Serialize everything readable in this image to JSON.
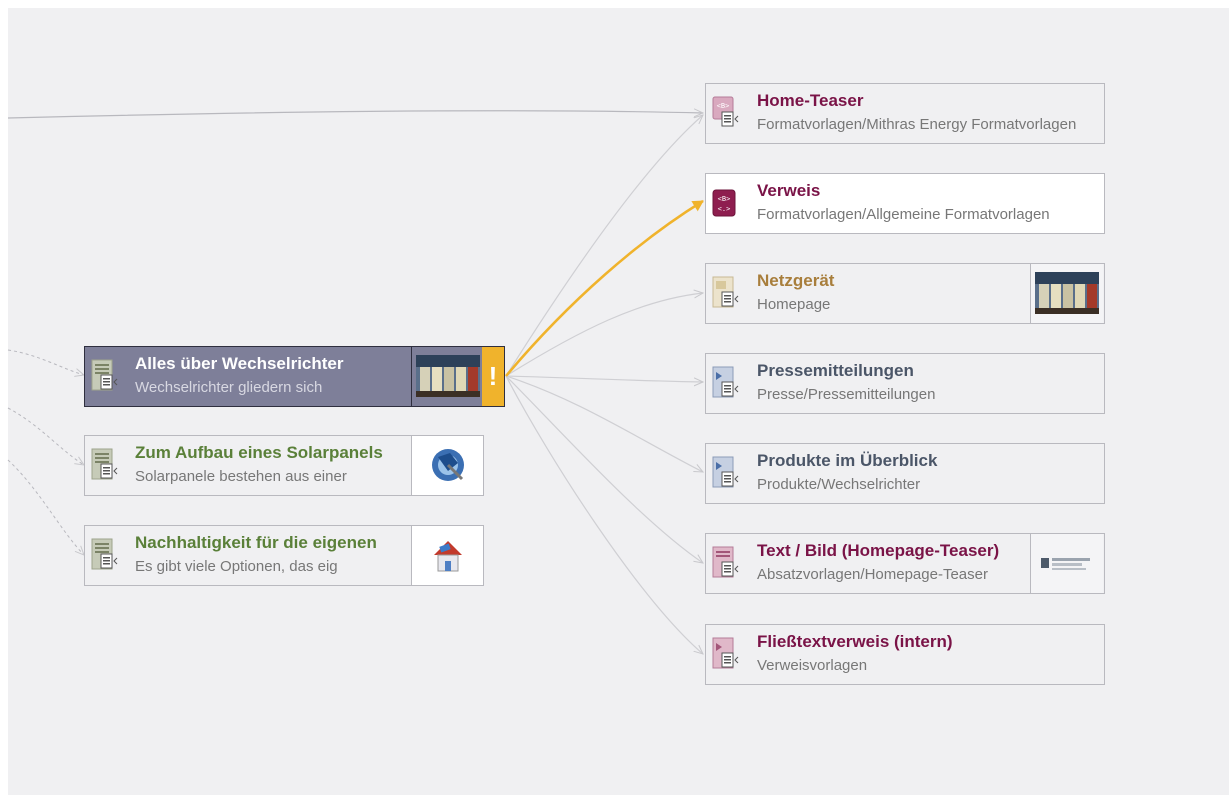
{
  "colors": {
    "canvas": "#f0f0f2",
    "edge": "#c8c8cc",
    "edge_highlight": "#f0b32c",
    "title_purple": "#7a1347",
    "title_slate": "#4b5668",
    "title_gold": "#a87e3c",
    "title_green": "#5a8039",
    "selected_bg": "#7e7f99",
    "warning": "#f0b32c"
  },
  "left_nodes": [
    {
      "title": "Alles über Wechselrichter",
      "subtitle": "Wechselrichter gliedern sich",
      "icon": "page-template-icon",
      "thumb": "product-photo-thumbnail",
      "warning": "!",
      "selected": true
    },
    {
      "title": "Zum Aufbau eines Solarpanels",
      "subtitle": "Solarpanele bestehen aus einer",
      "icon": "page-template-icon",
      "thumb": "solar-globe-thumbnail",
      "selected": false
    },
    {
      "title": "Nachhaltigkeit für die eigenen",
      "subtitle": "Es gibt viele Optionen, das eig",
      "icon": "page-template-icon",
      "thumb": "house-thumbnail",
      "selected": false
    }
  ],
  "right_nodes": [
    {
      "title": "Home-Teaser",
      "subtitle": "Formatvorlagen/Mithras Energy Formatvorlagen",
      "icon": "format-template-icon"
    },
    {
      "title": "Verweis",
      "subtitle": "Formatvorlagen/Allgemeine Formatvorlagen",
      "icon": "format-template-icon"
    },
    {
      "title": "Netzgerät",
      "subtitle": "Homepage",
      "icon": "page-icon",
      "thumb": "product-photo-thumbnail"
    },
    {
      "title": "Pressemitteilungen",
      "subtitle": "Presse/Pressemitteilungen",
      "icon": "page-reference-icon"
    },
    {
      "title": "Produkte im Überblick",
      "subtitle": "Produkte/Wechselrichter",
      "icon": "page-reference-icon"
    },
    {
      "title": "Text / Bild (Homepage-Teaser)",
      "subtitle": "Absatzvorlagen/Homepage-Teaser",
      "icon": "section-template-icon",
      "thumb": "logo-thumbnail"
    },
    {
      "title": "Fließtextverweis (intern)",
      "subtitle": "Verweisvorlagen",
      "icon": "link-template-icon"
    }
  ]
}
